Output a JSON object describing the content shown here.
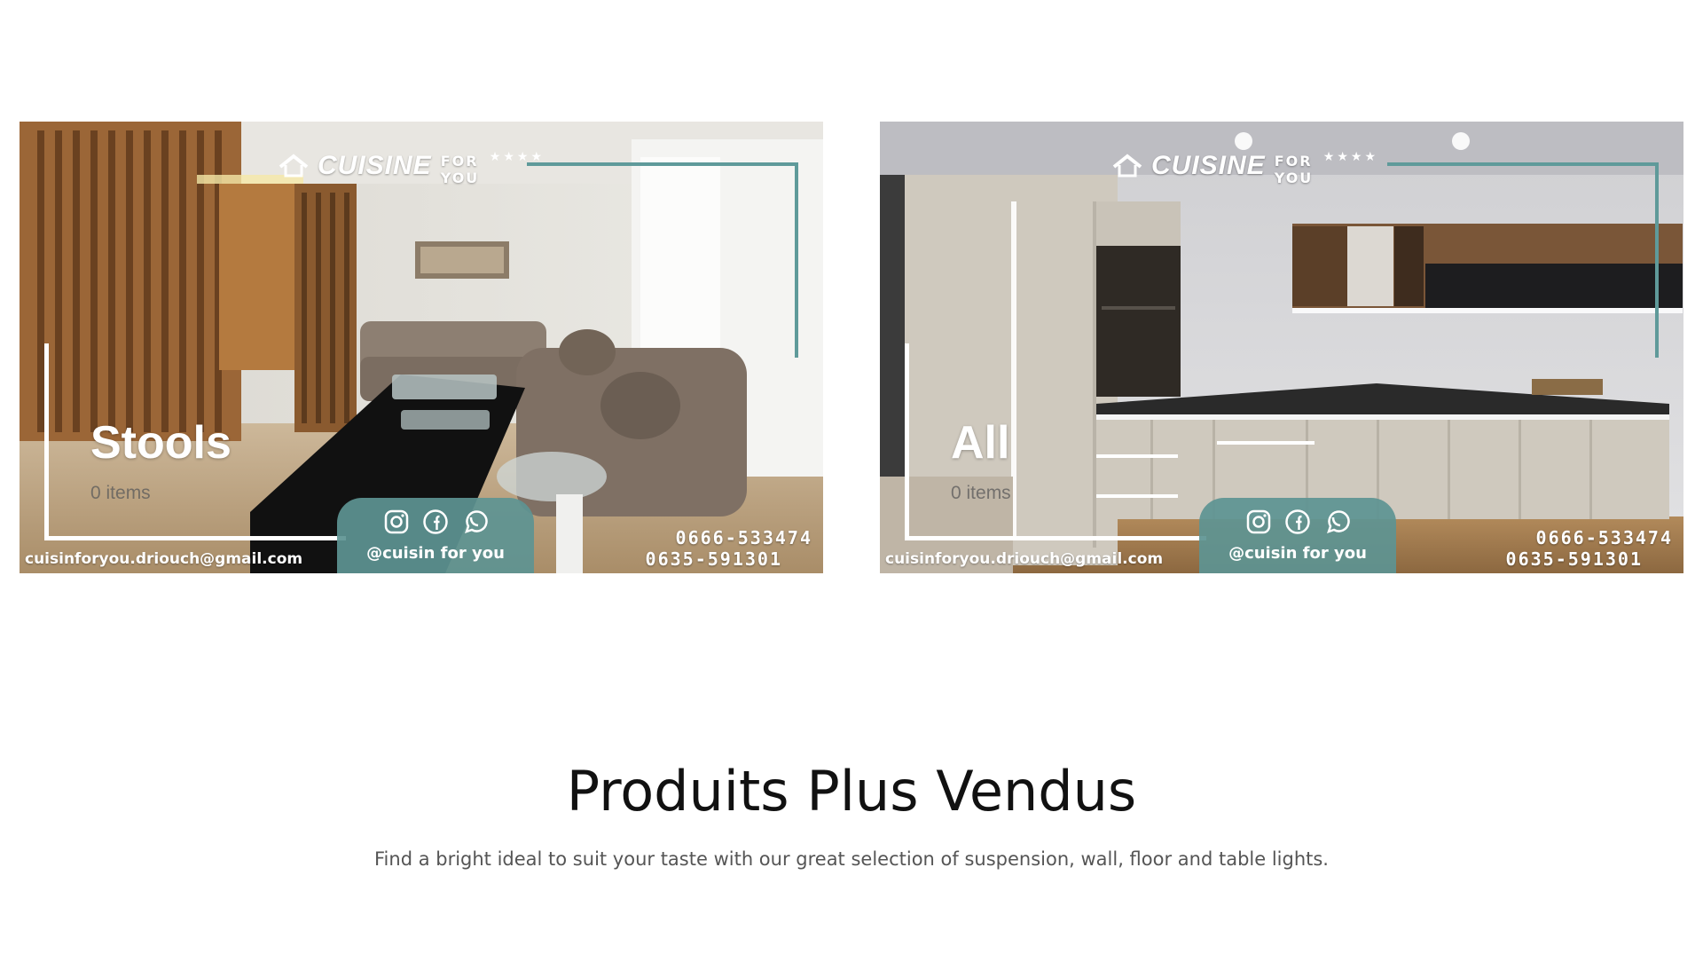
{
  "categories": [
    {
      "title": "Stools",
      "count": "0 items",
      "brand": {
        "name": "CUISINE",
        "tagline": "FOR YOU"
      },
      "social_handle": "@cuisin for you",
      "email": "cuisinforyou.driouch@gmail.com",
      "phones": [
        "0666-533474",
        "0635-591301"
      ],
      "social_icons": [
        "instagram-icon",
        "facebook-icon",
        "whatsapp-icon"
      ],
      "scene": "living-room"
    },
    {
      "title": "All",
      "count": "0 items",
      "brand": {
        "name": "CUISINE",
        "tagline": "FOR YOU"
      },
      "social_handle": "@cuisin for you",
      "email": "cuisinforyou.driouch@gmail.com",
      "phones": [
        "0666-533474",
        "0635-591301"
      ],
      "social_icons": [
        "instagram-icon",
        "facebook-icon",
        "whatsapp-icon"
      ],
      "scene": "kitchen"
    }
  ],
  "best_sellers": {
    "title": "Produits Plus Vendus",
    "description": "Find a bright ideal to suit your taste with our great selection of suspension, wall, floor and table lights."
  },
  "colors": {
    "teal_accent": "#5f9a9a",
    "heading": "#111111",
    "body_text": "#555555"
  }
}
